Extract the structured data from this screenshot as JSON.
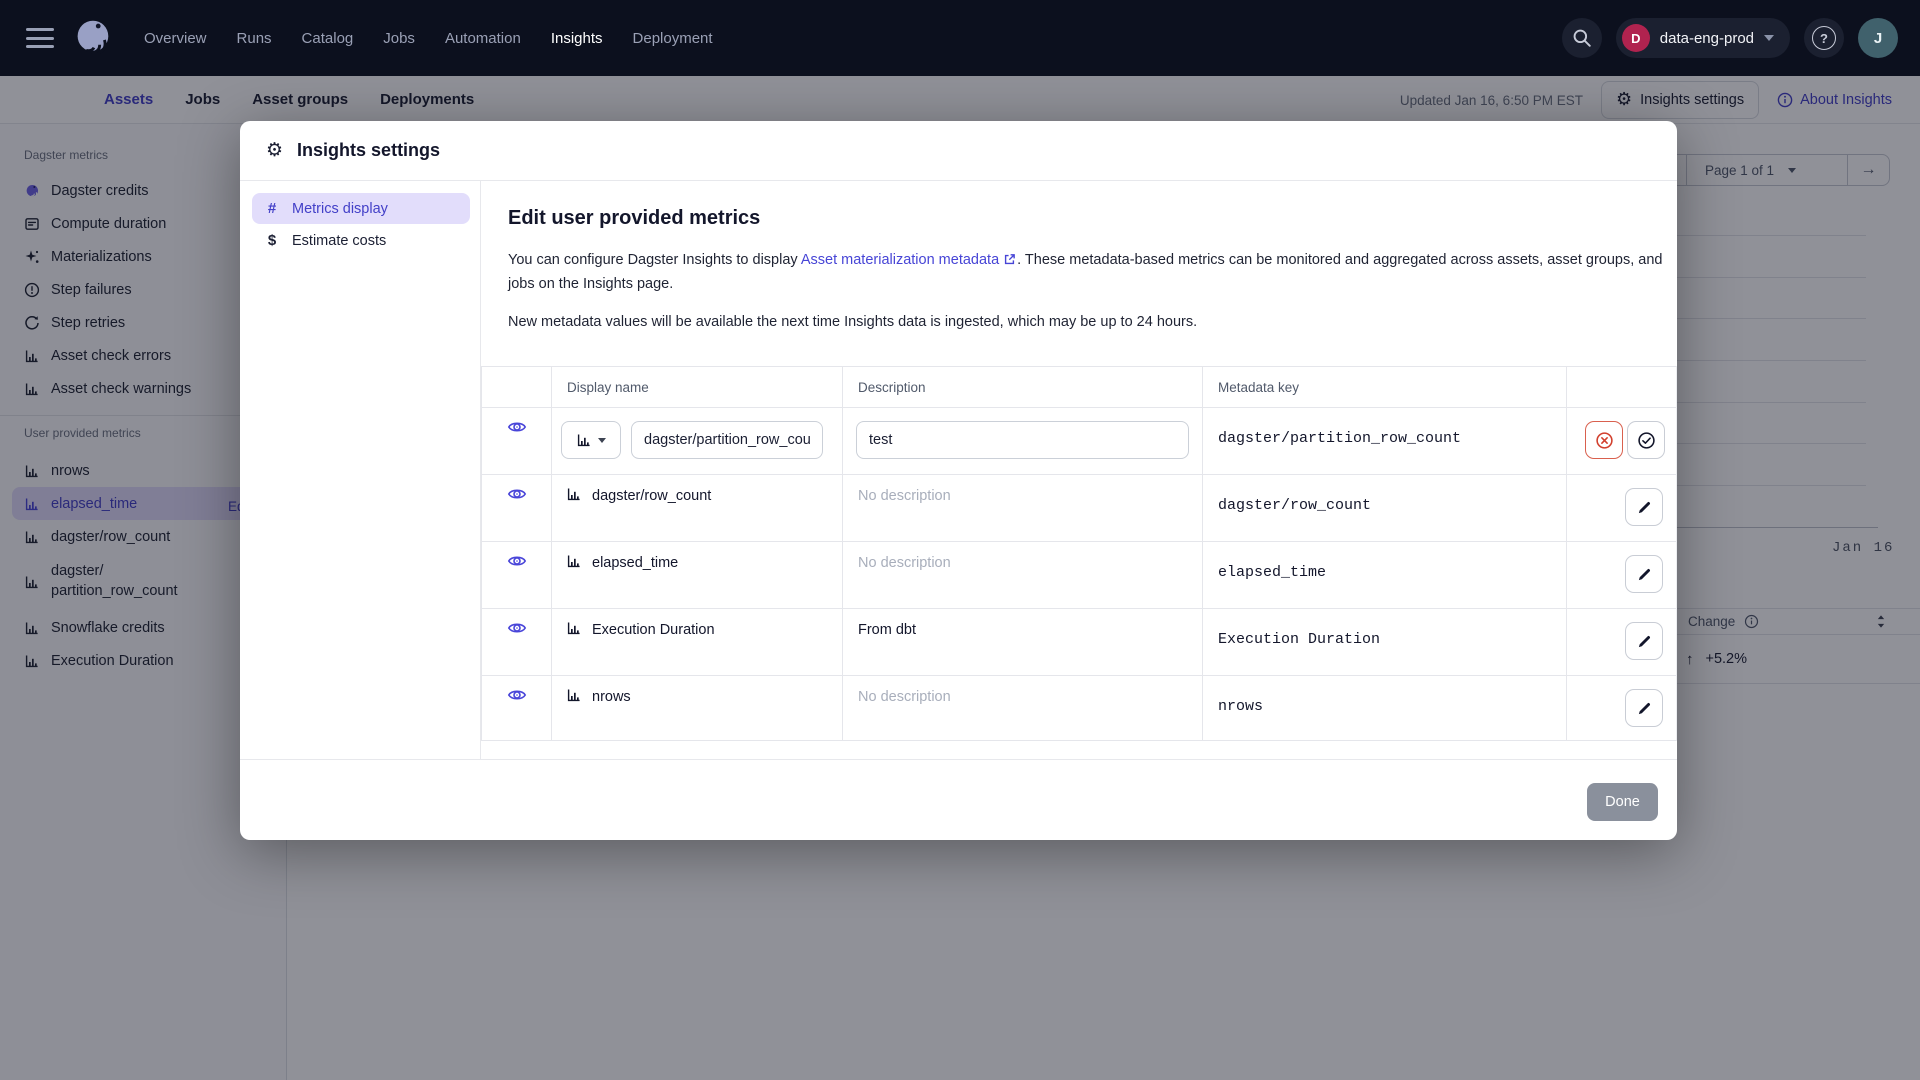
{
  "topnav": {
    "nav_items": [
      "Overview",
      "Runs",
      "Catalog",
      "Jobs",
      "Automation",
      "Insights",
      "Deployment"
    ],
    "active_item": "Insights",
    "deployment_badge": "D",
    "deployment_name": "data-eng-prod",
    "help_glyph": "?",
    "avatar_initial": "J"
  },
  "page_tabs": {
    "items": [
      "Assets",
      "Jobs",
      "Asset groups",
      "Deployments"
    ],
    "active": "Assets"
  },
  "page_header": {
    "updated": "Updated Jan 16, 6:50 PM EST",
    "settings_button": "Insights settings",
    "about_link": "About Insights"
  },
  "sidebar": {
    "dagster_section": {
      "label": "Dagster metrics",
      "items": [
        {
          "icon": "dagster-logo-icon",
          "label": "Dagster credits"
        },
        {
          "icon": "compute-duration-icon",
          "label": "Compute duration"
        },
        {
          "icon": "sparkle-icon",
          "label": "Materializations"
        },
        {
          "icon": "error-circle-icon",
          "label": "Step failures"
        },
        {
          "icon": "retry-icon",
          "label": "Step retries"
        },
        {
          "icon": "bar-chart-icon",
          "label": "Asset check errors"
        },
        {
          "icon": "bar-chart-icon",
          "label": "Asset check warnings"
        }
      ]
    },
    "user_section": {
      "label": "User provided metrics",
      "edit_link": "Edit",
      "items": [
        {
          "icon": "bar-chart-icon",
          "label": "nrows"
        },
        {
          "icon": "bar-chart-icon",
          "label": "elapsed_time",
          "selected": true
        },
        {
          "icon": "bar-chart-icon",
          "label": "dagster/row_count"
        },
        {
          "icon": "bar-chart-icon",
          "label": "dagster/",
          "label2": "partition_row_count"
        },
        {
          "icon": "bar-chart-icon",
          "label": "Snowflake credits"
        },
        {
          "icon": "bar-chart-icon",
          "label": "Execution Duration"
        }
      ]
    }
  },
  "background_page": {
    "pagination_label": "Page 1 of 1",
    "next_arrow": "→",
    "axis_label": "Jan 16",
    "change_column": "Change",
    "change_arrow": "↑",
    "change_value": "+5.2%"
  },
  "modal": {
    "title": "Insights settings",
    "gear_glyph": "⚙",
    "tabs": [
      {
        "glyph": "#",
        "label": "Metrics display"
      },
      {
        "glyph": "$",
        "label": "Estimate costs"
      }
    ],
    "active_tab": "Metrics display",
    "heading": "Edit user provided metrics",
    "intro_before_link": "You can configure Dagster Insights to display",
    "intro_link": "Asset materialization metadata",
    "intro_after_link": ". These metadata-based metrics can be monitored and aggregated across assets, asset groups, and jobs on the Insights page.",
    "intro_note": "New metadata values will be available the next time Insights data is ingested, which may be up to 24 hours.",
    "table": {
      "headers": [
        "Display name",
        "Description",
        "Metadata key"
      ],
      "edit_row": {
        "display_value": "dagster/partition_row_count",
        "description_value": "test",
        "metadata_key": "dagster/partition_row_count"
      },
      "rows": [
        {
          "display": "dagster/row_count",
          "description": "No description",
          "key": "dagster/row_count"
        },
        {
          "display": "elapsed_time",
          "description": "No description",
          "key": "elapsed_time"
        },
        {
          "display": "Execution Duration",
          "description": "From dbt",
          "key": "Execution Duration"
        },
        {
          "display": "nrows",
          "description": "No description",
          "key": "nrows"
        }
      ]
    },
    "done_button": "Done"
  }
}
